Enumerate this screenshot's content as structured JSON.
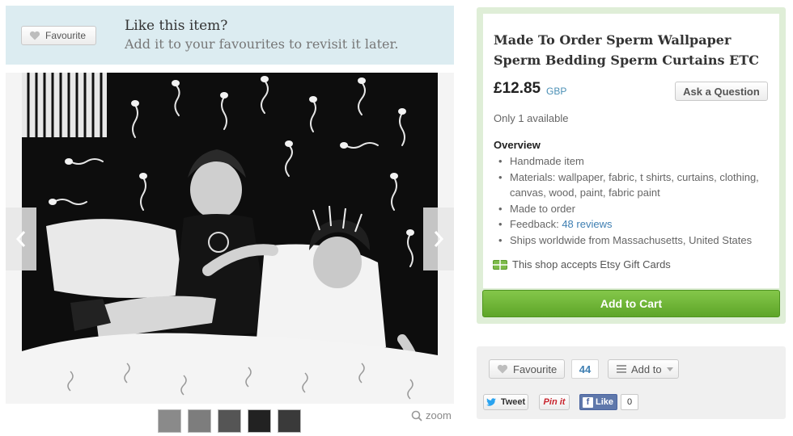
{
  "favourite_banner": {
    "button_label": "Favourite",
    "title": "Like this item?",
    "subtitle": "Add it to your favourites to revisit it later."
  },
  "gallery": {
    "thumbnail_count": 5,
    "zoom_label": "zoom"
  },
  "listing": {
    "title": "Made To Order Sperm Wallpaper Sperm Bedding Sperm Curtains ETC",
    "price": "£12.85",
    "currency": "GBP",
    "ask_button": "Ask a Question",
    "availability": "Only 1 available",
    "overview_heading": "Overview",
    "overview": {
      "handmade": "Handmade item",
      "materials": "Materials: wallpaper, fabric, t shirts, curtains, clothing, canvas, wood, paint, fabric paint",
      "made_to_order": "Made to order",
      "feedback_prefix": "Feedback:",
      "feedback_link": "48 reviews",
      "ships": "Ships worldwide from Massachusetts, United States"
    },
    "gift_cards": "This shop accepts Etsy Gift Cards",
    "add_to_cart": "Add to Cart"
  },
  "social": {
    "favourite_label": "Favourite",
    "favourite_count": "44",
    "add_to_label": "Add to",
    "tweet_label": "Tweet",
    "pinit_label": "Pin it",
    "like_label": "Like",
    "like_count": "0"
  },
  "colors": {
    "banner_bg": "#dcecf1",
    "buy_panel_bg": "#dfeed7",
    "cart_green": "#6cb234",
    "link_blue": "#3f7fb2"
  }
}
